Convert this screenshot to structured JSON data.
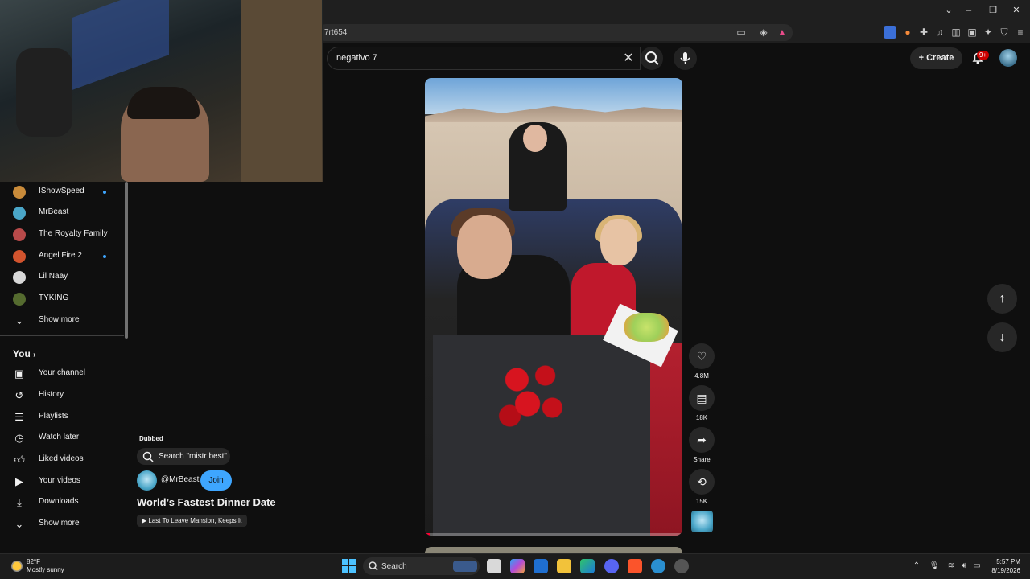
{
  "browser": {
    "url_fragment": "7rt654",
    "window_controls": [
      "⌄",
      "–",
      "❐",
      "✕"
    ]
  },
  "youtube": {
    "search": {
      "value": "negativo 7"
    },
    "create_label": "Create",
    "notifications_badge": "9+"
  },
  "sidebar": {
    "subscriptions": [
      {
        "label": "IShowSpeed",
        "color": "#c98b3a",
        "new": true
      },
      {
        "label": "MrBeast",
        "color": "#4aa6c8",
        "new": false
      },
      {
        "label": "The Royalty Family",
        "color": "#b84a4a",
        "new": false
      },
      {
        "label": "Angel Fire 2",
        "color": "#d2542e",
        "new": true
      },
      {
        "label": "Lil Naay",
        "color": "#d8d8d8",
        "new": false
      },
      {
        "label": "TYKING",
        "color": "#556b2f",
        "new": false
      }
    ],
    "show_more_1": "Show more",
    "you_heading": "You",
    "you_items": [
      {
        "label": "Your channel",
        "icon": "channel-icon"
      },
      {
        "label": "History",
        "icon": "history-icon"
      },
      {
        "label": "Playlists",
        "icon": "playlists-icon"
      },
      {
        "label": "Watch later",
        "icon": "watch-later-icon"
      },
      {
        "label": "Liked videos",
        "icon": "like-icon"
      },
      {
        "label": "Your videos",
        "icon": "your-videos-icon"
      },
      {
        "label": "Downloads",
        "icon": "download-icon"
      }
    ],
    "show_more_2": "Show more"
  },
  "video": {
    "dubbed_label": "Dubbed",
    "search_suggestion": "Search \"mistr best\"",
    "channel_handle": "@MrBeast",
    "join_label": "Join",
    "title": "World’s Fastest Dinner Date",
    "playlist_label": "Last To Leave Mansion, Keeps It",
    "progress": 0.02
  },
  "actions": {
    "likes": "4.8M",
    "comments": "18K",
    "share": "Share",
    "remix": "15K"
  },
  "taskbar": {
    "weather_temp": "82°F",
    "weather_desc": "Mostly sunny",
    "search_label": "Search",
    "time": "5:57 PM",
    "date": "8/19/2026"
  }
}
